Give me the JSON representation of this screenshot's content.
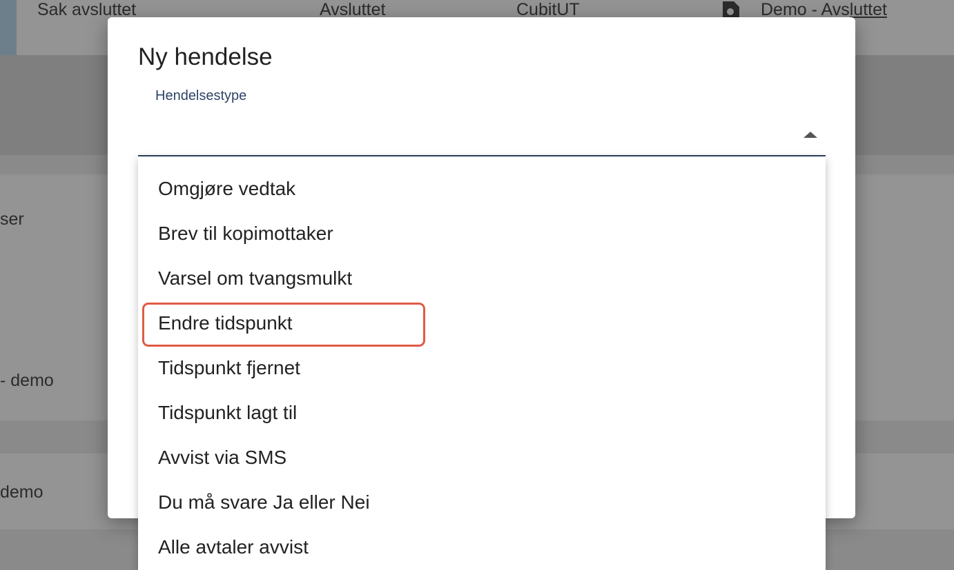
{
  "background": {
    "row_top": {
      "col1": "Sak avsluttet",
      "col2": "Avsluttet",
      "col3": "CubitUT",
      "col4_prefix": "Demo - Avs",
      "col4_link": "luttet"
    },
    "fragments": [
      "ser",
      "- demo",
      "demo"
    ]
  },
  "dialog": {
    "title": "Ny hendelse",
    "field_label": "Hendelsestype",
    "field_value": ""
  },
  "dropdown": {
    "options": [
      "Omgjøre vedtak",
      "Brev til kopimottaker",
      "Varsel om tvangsmulkt",
      "Endre tidspunkt",
      "Tidspunkt fjernet",
      "Tidspunkt lagt til",
      "Avvist via SMS",
      "Du må svare Ja eller Nei",
      "Alle avtaler avvist"
    ],
    "highlighted_option": "Endre tidspunkt"
  },
  "colors": {
    "overlay": "#8a8a8a",
    "highlight_border": "#e05a45",
    "field_underline": "#2c3e5a",
    "label_blue": "#2d4466"
  }
}
